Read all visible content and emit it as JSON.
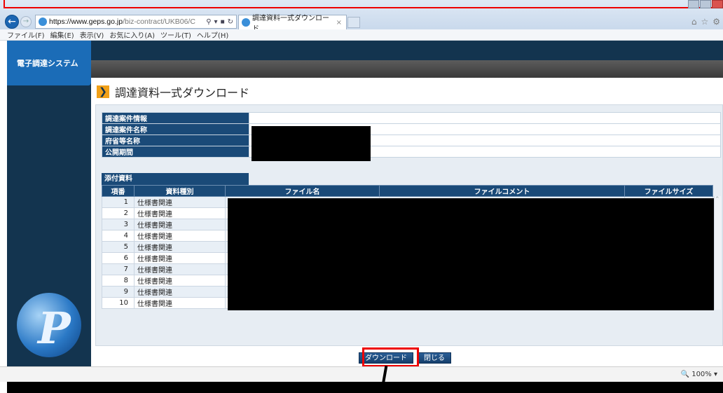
{
  "browser": {
    "url_host": "https://www.geps.go.jp",
    "url_path": "/biz-contract/UKB06/C",
    "tab_title": "調達資料一式ダウンロード",
    "menu": [
      "ファイル(F)",
      "編集(E)",
      "表示(V)",
      "お気に入り(A)",
      "ツール(T)",
      "ヘルプ(H)"
    ],
    "zoom": "100%"
  },
  "sidebar": {
    "brand": "電子調達システム"
  },
  "page": {
    "title": "調達資料一式ダウンロード",
    "info_labels": [
      "調達案件情報",
      "調達案件名称",
      "府省等名称",
      "公開期間"
    ],
    "attachments_label": "添付資料",
    "file_headers": [
      "項番",
      "資料種別",
      "ファイル名",
      "ファイルコメント",
      "ファイルサイズ"
    ],
    "files": [
      {
        "no": "1",
        "type": "仕様書関連"
      },
      {
        "no": "2",
        "type": "仕様書関連"
      },
      {
        "no": "3",
        "type": "仕様書関連"
      },
      {
        "no": "4",
        "type": "仕様書関連"
      },
      {
        "no": "5",
        "type": "仕様書関連"
      },
      {
        "no": "6",
        "type": "仕様書関連"
      },
      {
        "no": "7",
        "type": "仕様書関連"
      },
      {
        "no": "8",
        "type": "仕様書関連"
      },
      {
        "no": "9",
        "type": "仕様書関連"
      },
      {
        "no": "10",
        "type": "仕様書関連"
      }
    ],
    "download_label": "ダウンロード",
    "close_label": "閉じる"
  }
}
